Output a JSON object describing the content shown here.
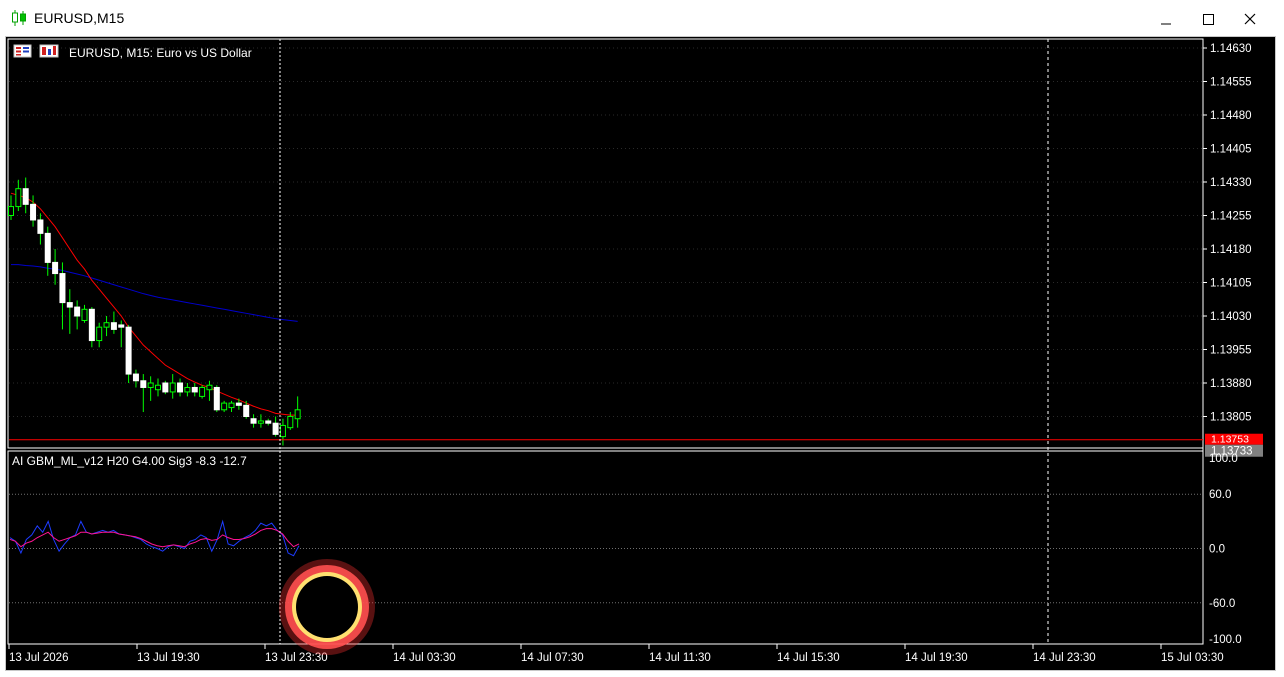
{
  "window": {
    "title": "EURUSD,M15"
  },
  "chart_header": {
    "symbol_label": "EURUSD, M15:  Euro vs US Dollar"
  },
  "indicator_header": {
    "label": "AI GBM_ML_v12 H20 G4.00 Sig3 -8.3 -12.7"
  },
  "price_axis": {
    "ticks": [
      "1.14630",
      "1.14555",
      "1.14480",
      "1.14405",
      "1.14330",
      "1.14255",
      "1.14180",
      "1.14105",
      "1.14030",
      "1.13955",
      "1.13880",
      "1.13805"
    ],
    "bid_label": "1.13753",
    "last_label": "1.13733"
  },
  "indicator_axis": {
    "ticks": [
      "100.0",
      "60.0",
      "0.0",
      "-60.0",
      "-100.0"
    ]
  },
  "time_axis": {
    "ticks": [
      "13 Jul 2026",
      "13 Jul 19:30",
      "13 Jul 23:30",
      "14 Jul 03:30",
      "14 Jul 07:30",
      "14 Jul 11:30",
      "14 Jul 15:30",
      "14 Jul 19:30",
      "14 Jul 23:30",
      "15 Jul 03:30"
    ]
  },
  "colors": {
    "background": "#000000",
    "bull_candle": "#00ff00",
    "bear_candle": "#ffffff",
    "fast_ma": "#ff0000",
    "slow_ma": "#0000cd",
    "bid_line": "#ff0000",
    "indicator_main": "#1e3cff",
    "indicator_signal": "#ff1493",
    "click_marker": "#ff5050"
  },
  "chart_data": [
    {
      "type": "candlestick",
      "title": "EURUSD, M15:  Euro vs US Dollar",
      "ylim": [
        1.1372,
        1.1465
      ],
      "candles": [
        {
          "o": 1.14255,
          "h": 1.143,
          "l": 1.14245,
          "c": 1.14275
        },
        {
          "o": 1.14275,
          "h": 1.14335,
          "l": 1.14265,
          "c": 1.14315
        },
        {
          "o": 1.14315,
          "h": 1.1434,
          "l": 1.1426,
          "c": 1.1428
        },
        {
          "o": 1.1428,
          "h": 1.143,
          "l": 1.1423,
          "c": 1.14245
        },
        {
          "o": 1.14245,
          "h": 1.1426,
          "l": 1.1419,
          "c": 1.14215
        },
        {
          "o": 1.14215,
          "h": 1.1423,
          "l": 1.1412,
          "c": 1.1415
        },
        {
          "o": 1.1415,
          "h": 1.1418,
          "l": 1.141,
          "c": 1.14125
        },
        {
          "o": 1.14125,
          "h": 1.1415,
          "l": 1.14,
          "c": 1.1406
        },
        {
          "o": 1.1406,
          "h": 1.1409,
          "l": 1.1399,
          "c": 1.1405
        },
        {
          "o": 1.1405,
          "h": 1.14065,
          "l": 1.14,
          "c": 1.1403
        },
        {
          "o": 1.1402,
          "h": 1.14055,
          "l": 1.14015,
          "c": 1.14045
        },
        {
          "o": 1.14045,
          "h": 1.1405,
          "l": 1.1396,
          "c": 1.13975
        },
        {
          "o": 1.13975,
          "h": 1.14015,
          "l": 1.1396,
          "c": 1.14005
        },
        {
          "o": 1.14005,
          "h": 1.1403,
          "l": 1.13985,
          "c": 1.14015
        },
        {
          "o": 1.14015,
          "h": 1.1404,
          "l": 1.1399,
          "c": 1.14
        },
        {
          "o": 1.1401,
          "h": 1.1402,
          "l": 1.1396,
          "c": 1.14005
        },
        {
          "o": 1.14005,
          "h": 1.1401,
          "l": 1.1388,
          "c": 1.139
        },
        {
          "o": 1.139,
          "h": 1.1391,
          "l": 1.1387,
          "c": 1.13885
        },
        {
          "o": 1.13885,
          "h": 1.139,
          "l": 1.13815,
          "c": 1.1387
        },
        {
          "o": 1.1387,
          "h": 1.13895,
          "l": 1.1384,
          "c": 1.1388
        },
        {
          "o": 1.13865,
          "h": 1.1389,
          "l": 1.1385,
          "c": 1.13875
        },
        {
          "o": 1.1388,
          "h": 1.13885,
          "l": 1.13855,
          "c": 1.1386
        },
        {
          "o": 1.1386,
          "h": 1.139,
          "l": 1.13845,
          "c": 1.1388
        },
        {
          "o": 1.1388,
          "h": 1.1389,
          "l": 1.1385,
          "c": 1.1386
        },
        {
          "o": 1.1386,
          "h": 1.1388,
          "l": 1.1385,
          "c": 1.1387
        },
        {
          "o": 1.1387,
          "h": 1.1388,
          "l": 1.1385,
          "c": 1.1386
        },
        {
          "o": 1.1385,
          "h": 1.13875,
          "l": 1.13845,
          "c": 1.1387
        },
        {
          "o": 1.13865,
          "h": 1.13885,
          "l": 1.1384,
          "c": 1.13875
        },
        {
          "o": 1.1387,
          "h": 1.13875,
          "l": 1.13815,
          "c": 1.1382
        },
        {
          "o": 1.1382,
          "h": 1.1384,
          "l": 1.13815,
          "c": 1.13835
        },
        {
          "o": 1.13825,
          "h": 1.1384,
          "l": 1.13815,
          "c": 1.13835
        },
        {
          "o": 1.13835,
          "h": 1.13845,
          "l": 1.1382,
          "c": 1.1383
        },
        {
          "o": 1.1383,
          "h": 1.1384,
          "l": 1.138,
          "c": 1.13805
        },
        {
          "o": 1.138,
          "h": 1.1381,
          "l": 1.1378,
          "c": 1.1379
        },
        {
          "o": 1.1379,
          "h": 1.1381,
          "l": 1.1378,
          "c": 1.13795
        },
        {
          "o": 1.13795,
          "h": 1.138,
          "l": 1.13785,
          "c": 1.1379
        },
        {
          "o": 1.1379,
          "h": 1.13805,
          "l": 1.1376,
          "c": 1.13765
        },
        {
          "o": 1.1376,
          "h": 1.138,
          "l": 1.1374,
          "c": 1.13785
        },
        {
          "o": 1.1378,
          "h": 1.13815,
          "l": 1.13775,
          "c": 1.13805
        },
        {
          "o": 1.138,
          "h": 1.1385,
          "l": 1.1378,
          "c": 1.1382
        }
      ],
      "fast_ma": [
        1.14305,
        1.143,
        1.14295,
        1.14285,
        1.1427,
        1.1425,
        1.1423,
        1.14205,
        1.1418,
        1.14155,
        1.14135,
        1.1411,
        1.1409,
        1.1407,
        1.1405,
        1.1403,
        1.14005,
        1.13985,
        1.13965,
        1.1395,
        1.13935,
        1.1392,
        1.1391,
        1.139,
        1.1389,
        1.13882,
        1.13875,
        1.1387,
        1.13862,
        1.13855,
        1.13848,
        1.13842,
        1.13835,
        1.13828,
        1.13822,
        1.13818,
        1.13812,
        1.1381,
        1.13808,
        1.13808
      ],
      "slow_ma": [
        1.14145,
        1.14145,
        1.14143,
        1.14142,
        1.1414,
        1.14137,
        1.14135,
        1.14132,
        1.14128,
        1.14124,
        1.1412,
        1.14115,
        1.1411,
        1.14105,
        1.141,
        1.14095,
        1.1409,
        1.14085,
        1.1408,
        1.14076,
        1.14072,
        1.14069,
        1.14066,
        1.14063,
        1.1406,
        1.14057,
        1.14054,
        1.14051,
        1.14048,
        1.14045,
        1.14042,
        1.14039,
        1.14036,
        1.14033,
        1.1403,
        1.14027,
        1.14024,
        1.14022,
        1.1402,
        1.14018
      ],
      "bid": 1.13753
    },
    {
      "type": "line",
      "title": "AI GBM_ML_v12 H20 G4.00 Sig3 -8.3 -12.7",
      "ylim": [
        -100,
        100
      ],
      "levels": [
        60,
        0,
        -60
      ],
      "series": [
        {
          "values": [
            12,
            8,
            -5,
            10,
            15,
            25,
            18,
            30,
            10,
            -3,
            5,
            12,
            15,
            30,
            18,
            16,
            18,
            20,
            18,
            20,
            16,
            15,
            14,
            12,
            10,
            5,
            2,
            0,
            -3,
            2,
            4,
            2,
            0,
            8,
            10,
            15,
            12,
            -3,
            10,
            30,
            5,
            3,
            8,
            12,
            15,
            20,
            28,
            25,
            28,
            20,
            15,
            -5,
            -8,
            3
          ]
        },
        {
          "values": [
            10,
            8,
            2,
            6,
            8,
            12,
            15,
            18,
            12,
            8,
            10,
            12,
            14,
            18,
            18,
            16,
            17,
            18,
            18,
            18,
            16,
            15,
            14,
            13,
            11,
            8,
            5,
            3,
            2,
            3,
            4,
            3,
            2,
            5,
            7,
            10,
            11,
            9,
            10,
            15,
            12,
            10,
            10,
            11,
            13,
            16,
            20,
            22,
            22,
            20,
            16,
            8,
            2,
            5
          ]
        }
      ]
    }
  ]
}
